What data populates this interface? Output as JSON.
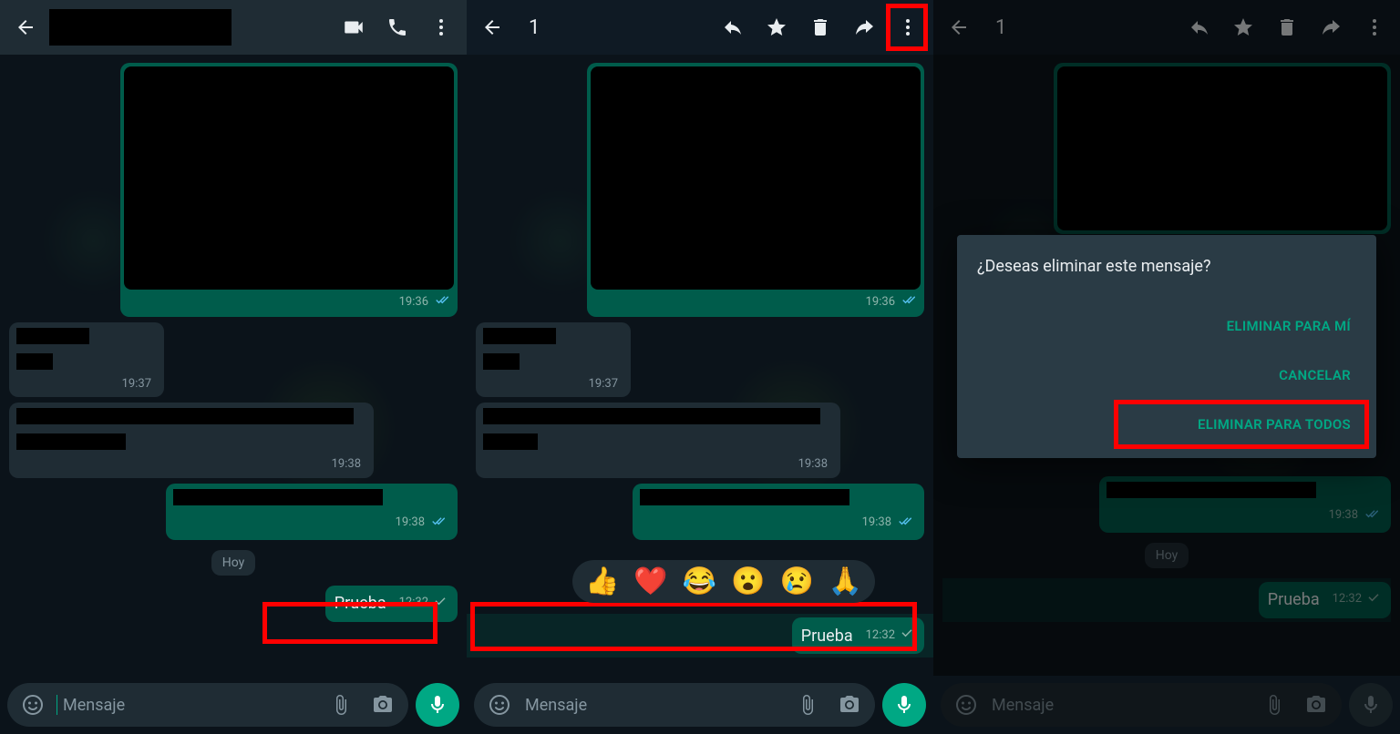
{
  "colors": {
    "accent": "#00a884",
    "bubbleOut": "#005c4b",
    "bubbleIn": "#1f2c34",
    "highlight": "#f00"
  },
  "shared": {
    "imgTime": "19:36",
    "in1Time": "19:37",
    "in2Time": "19:38",
    "out1Time": "19:38",
    "dateLabel": "Hoy",
    "testMsg": "Prueba",
    "testTime": "12:32",
    "inputPlaceholder": "Mensaje"
  },
  "screen2": {
    "selCount": "1",
    "reactions": [
      "👍",
      "❤️",
      "😂",
      "😮",
      "😢",
      "🙏"
    ]
  },
  "screen3": {
    "selCount": "1",
    "dialogTitle": "¿Deseas eliminar este mensaje?",
    "opt1": "ELIMINAR PARA MÍ",
    "opt2": "CANCELAR",
    "opt3": "ELIMINAR PARA TODOS"
  }
}
